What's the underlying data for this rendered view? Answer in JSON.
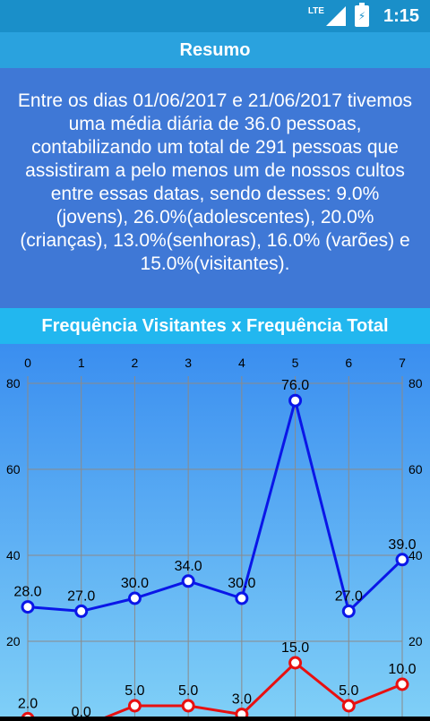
{
  "status_bar": {
    "network": "LTE",
    "time": "1:15"
  },
  "header": {
    "title": "Resumo"
  },
  "summary": {
    "text": "Entre os dias 01/06/2017 e 21/06/2017 tivemos uma média diária de 36.0 pessoas, contabilizando um total de 291 pessoas que assistiram a pelo menos um de nossos cultos entre essas datas, sendo desses: 9.0%(jovens), 26.0%(adolescentes), 20.0%(crianças), 13.0%(senhoras), 16.0% (varões) e 15.0%(visitantes)."
  },
  "chart_title": "Frequência Visitantes x Frequência Total",
  "colors": {
    "total_line": "#0a16e8",
    "visitantes_line": "#e81010"
  },
  "chart_data": {
    "type": "line",
    "x": [
      0,
      1,
      2,
      3,
      4,
      5,
      6,
      7
    ],
    "x_tick_labels": [
      "0",
      "1",
      "2",
      "3",
      "4",
      "5",
      "6",
      "7"
    ],
    "y_tick_labels": [
      "20",
      "40",
      "60",
      "80"
    ],
    "ylim": [
      0,
      85
    ],
    "grid": true,
    "series": [
      {
        "color": "#0a16e8",
        "values": [
          28.0,
          27.0,
          30.0,
          34.0,
          30.0,
          76.0,
          27.0,
          39.0
        ],
        "labels": [
          "28.0",
          "27.0",
          "30.0",
          "34.0",
          "30.0",
          "76.0",
          "27.0",
          "39.0"
        ]
      },
      {
        "color": "#e81010",
        "values": [
          2.0,
          0.0,
          5.0,
          5.0,
          3.0,
          15.0,
          5.0,
          10.0
        ],
        "labels": [
          "2.0",
          "0.0",
          "5.0",
          "5.0",
          "3.0",
          "15.0",
          "5.0",
          "10.0"
        ]
      }
    ]
  }
}
